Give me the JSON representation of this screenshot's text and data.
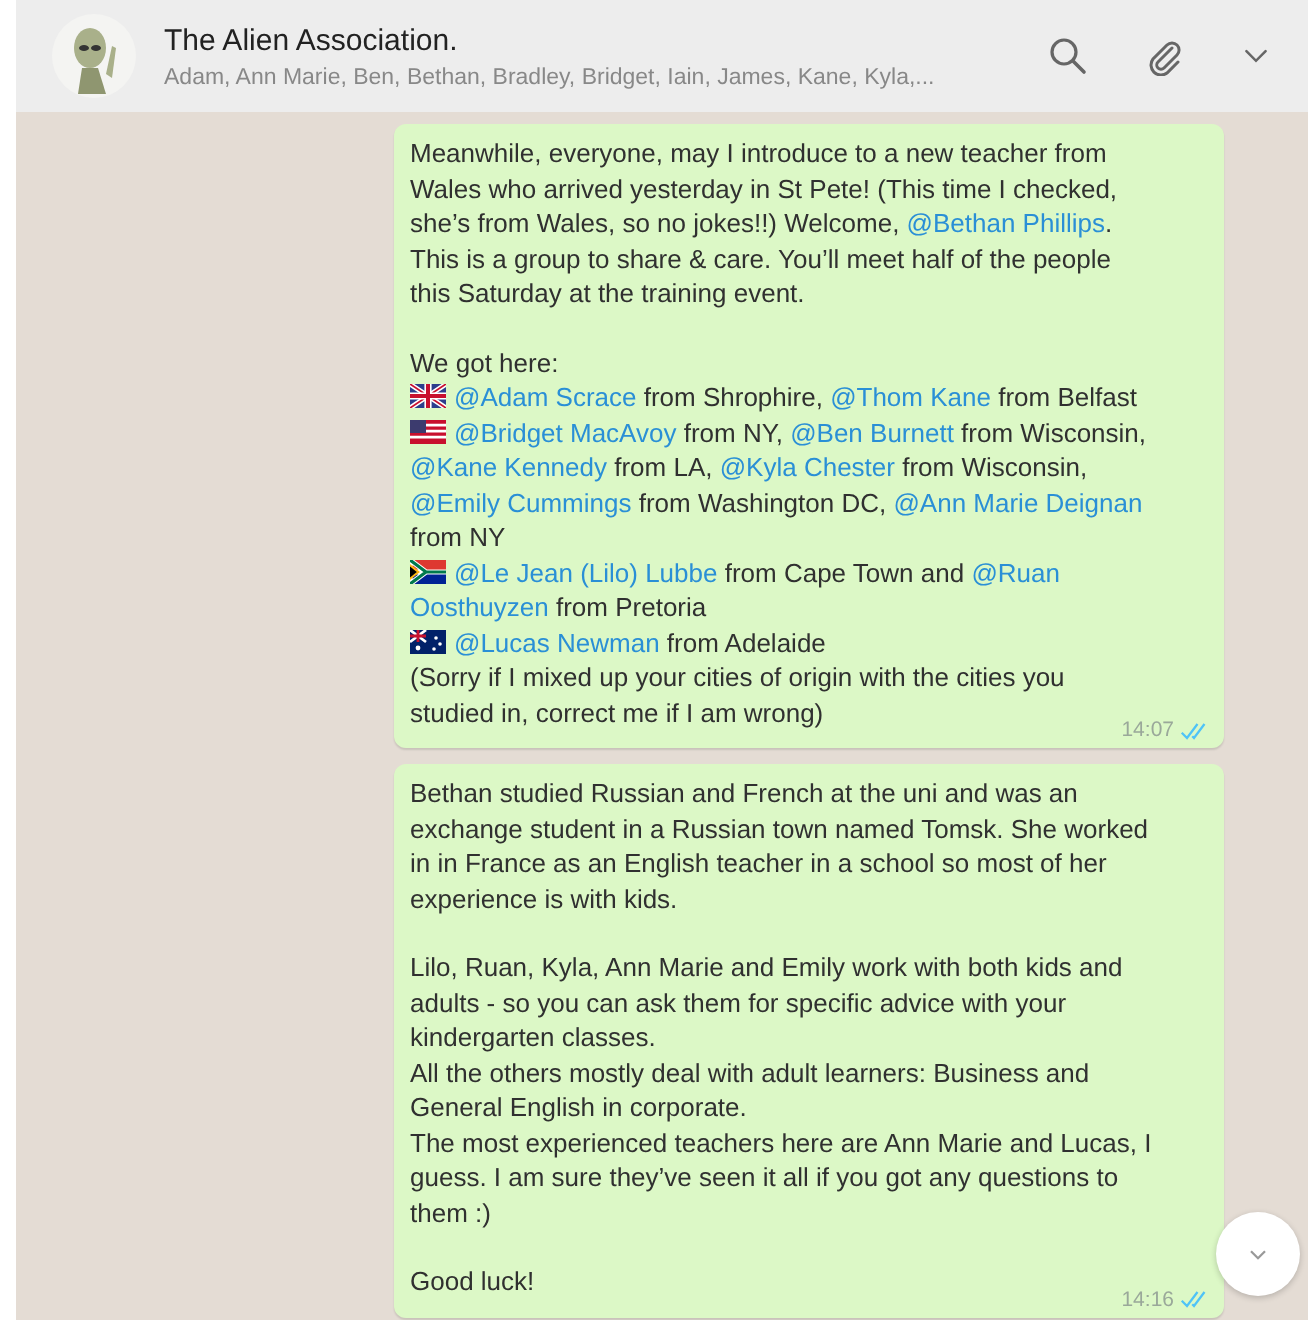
{
  "header": {
    "title": "The Alien Association.",
    "members": "Adam, Ann Marie, Ben, Bethan, Bradley, Bridget, Iain, James, Kane, Kyla,..."
  },
  "messages": [
    {
      "time": "14:07",
      "read": true,
      "paragraphs": [
        {
          "lines": [
            {
              "segments": [
                {
                  "kind": "text",
                  "text": "Meanwhile, everyone, may I introduce to a new teacher from"
                }
              ]
            },
            {
              "segments": [
                {
                  "kind": "text",
                  "text": "Wales who arrived yesterday in St Pete! (This time I checked,"
                }
              ]
            },
            {
              "segments": [
                {
                  "kind": "text",
                  "text": "she’s from Wales, so no jokes!!) Welcome, "
                },
                {
                  "kind": "mention",
                  "text": "@Bethan Phillips"
                },
                {
                  "kind": "text",
                  "text": "."
                }
              ]
            },
            {
              "segments": [
                {
                  "kind": "text",
                  "text": "This is a group to share & care. You’ll meet half of the people"
                }
              ]
            },
            {
              "segments": [
                {
                  "kind": "text",
                  "text": "this Saturday at the training event."
                }
              ]
            }
          ]
        },
        {
          "lines": [
            {
              "segments": [
                {
                  "kind": "text",
                  "text": "We got here:"
                }
              ]
            },
            {
              "kind": "britain",
              "segments": [
                {
                  "kind": "mention",
                  "text": "@Adam Scrace"
                },
                {
                  "kind": "text",
                  "text": " from Shrophire, "
                },
                {
                  "kind": "mention",
                  "text": "@Thom Kane"
                },
                {
                  "kind": "text",
                  "text": " from Belfast"
                }
              ]
            },
            {
              "kind": "usa",
              "segments": [
                {
                  "kind": "mention",
                  "text": "@Bridget MacAvoy"
                },
                {
                  "kind": "text",
                  "text": " from NY, "
                },
                {
                  "kind": "mention",
                  "text": "@Ben Burnett"
                },
                {
                  "kind": "text",
                  "text": " from Wisconsin,"
                }
              ]
            },
            {
              "segments": [
                {
                  "kind": "mention",
                  "text": "@Kane Kennedy"
                },
                {
                  "kind": "text",
                  "text": " from LA, "
                },
                {
                  "kind": "mention",
                  "text": "@Kyla Chester"
                },
                {
                  "kind": "text",
                  "text": " from Wisconsin,"
                }
              ]
            },
            {
              "segments": [
                {
                  "kind": "mention",
                  "text": "@Emily Cummings"
                },
                {
                  "kind": "text",
                  "text": " from Washington DC, "
                },
                {
                  "kind": "mention",
                  "text": "@Ann Marie Deignan"
                }
              ]
            },
            {
              "segments": [
                {
                  "kind": "text",
                  "text": "from NY"
                }
              ]
            },
            {
              "kind": "southafrica",
              "segments": [
                {
                  "kind": "mention",
                  "text": "@Le Jean (Lilo) Lubbe"
                },
                {
                  "kind": "text",
                  "text": " from Cape Town and "
                },
                {
                  "kind": "mention",
                  "text": "@Ruan"
                }
              ]
            },
            {
              "segments": [
                {
                  "kind": "mention",
                  "text": "Oosthuyzen"
                },
                {
                  "kind": "text",
                  "text": " from Pretoria"
                }
              ]
            },
            {
              "kind": "australia",
              "segments": [
                {
                  "kind": "mention",
                  "text": "@Lucas Newman"
                },
                {
                  "kind": "text",
                  "text": " from Adelaide"
                }
              ]
            },
            {
              "segments": [
                {
                  "kind": "text",
                  "text": "(Sorry if I mixed up your cities of origin with the cities you"
                }
              ]
            },
            {
              "segments": [
                {
                  "kind": "text",
                  "text": "studied in, correct me if I am wrong)"
                }
              ]
            }
          ]
        }
      ]
    },
    {
      "time": "14:16",
      "read": true,
      "paragraphs": [
        {
          "lines": [
            {
              "segments": [
                {
                  "kind": "text",
                  "text": "Bethan studied Russian and French at the uni and was an"
                }
              ]
            },
            {
              "segments": [
                {
                  "kind": "text",
                  "text": "exchange student in a Russian town named Tomsk. She worked"
                }
              ]
            },
            {
              "segments": [
                {
                  "kind": "text",
                  "text": "in in France as an English teacher in a school so most of her"
                }
              ]
            },
            {
              "segments": [
                {
                  "kind": "text",
                  "text": "experience is with kids."
                }
              ]
            }
          ]
        },
        {
          "lines": [
            {
              "segments": [
                {
                  "kind": "text",
                  "text": "Lilo, Ruan, Kyla, Ann Marie and Emily work with both kids and"
                }
              ]
            },
            {
              "segments": [
                {
                  "kind": "text",
                  "text": "adults - so you can ask them for specific advice with your"
                }
              ]
            },
            {
              "segments": [
                {
                  "kind": "text",
                  "text": "kindergarten classes."
                }
              ]
            },
            {
              "segments": [
                {
                  "kind": "text",
                  "text": "All the others mostly deal with adult learners: Business and"
                }
              ]
            },
            {
              "segments": [
                {
                  "kind": "text",
                  "text": "General English in corporate."
                }
              ]
            },
            {
              "segments": [
                {
                  "kind": "text",
                  "text": "The most experienced teachers here are Ann Marie and Lucas, I"
                }
              ]
            },
            {
              "segments": [
                {
                  "kind": "text",
                  "text": "guess. I am sure they’ve seen it all if you got any questions to"
                }
              ]
            },
            {
              "segments": [
                {
                  "kind": "text",
                  "text": "them :)"
                }
              ]
            }
          ]
        },
        {
          "lines": [
            {
              "segments": [
                {
                  "kind": "text",
                  "text": "Good luck!"
                }
              ]
            }
          ]
        }
      ]
    }
  ]
}
